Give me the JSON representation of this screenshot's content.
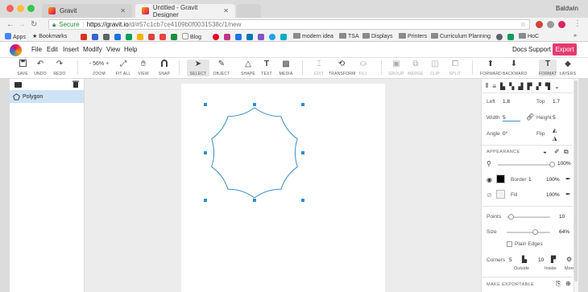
{
  "browser": {
    "tabs": [
      {
        "title": "Gravit",
        "active": false
      },
      {
        "title": "Untitled - Gravit Designer",
        "active": true
      }
    ],
    "profile_name": "Baldwin",
    "secure_label": "Secure",
    "url_host": "https://gravit.io",
    "url_path": "/d/#57c1cb7ce4109b0f0031538c/1/new",
    "bookmarks": [
      "Apps",
      "Bookmarks",
      "Blog",
      "modern idea",
      "TSA",
      "Displays",
      "Printers",
      "Curriculum Planning",
      "HoC"
    ],
    "more_label": "»"
  },
  "app": {
    "menus": [
      "File",
      "Edit",
      "Insert",
      "Modify",
      "View",
      "Help"
    ],
    "right_links": [
      "Docs",
      "Support"
    ],
    "export_label": "Export"
  },
  "toolbar": {
    "save": "SAVE",
    "undo": "UNDO",
    "redo": "REDO",
    "zoom_minus": "-",
    "zoom_value": "56%",
    "zoom_plus": "+",
    "zoom": "ZOOM",
    "fit_all": "FIT ALL",
    "view": "VIEW",
    "snap": "SNAP",
    "select": "SELECT",
    "object": "OBJECT",
    "shape": "SHAPE",
    "text": "TEXT",
    "media": "MEDIA",
    "edit": "EDIT",
    "transform": "TRANSFORM",
    "fill": "FILL",
    "group": "GROUP",
    "merge": "MERGE",
    "clip": "CLIP",
    "split": "SPLIT",
    "forward": "FORWARD",
    "backward": "BACKWARD",
    "format": "FORMAT",
    "layers": "LAYERS"
  },
  "layers": {
    "items": [
      {
        "name": "Polygon",
        "selected": true
      }
    ]
  },
  "inspector": {
    "left_label": "Left",
    "left_value": "1.8",
    "top_label": "Top",
    "top_value": "1.7",
    "width_label": "Width",
    "width_value": "5",
    "height_label": "Height",
    "height_value": "5",
    "angle_label": "Angle",
    "angle_value": "0°",
    "flip_label": "Flip",
    "appearance_title": "APPEARANCE",
    "opacity_value": "100%",
    "border_label": "Border",
    "border_width": "1",
    "border_opacity": "100%",
    "border_color": "#000000",
    "fill_label": "Fill",
    "fill_opacity": "100%",
    "fill_color": "#f2f2f2",
    "points_label": "Points",
    "points_value": "10",
    "points_fraction": 0.1,
    "size_label": "Size",
    "size_value": "64%",
    "size_fraction": 0.64,
    "plain_edges_label": "Plain Edges",
    "corners_label": "Corners",
    "corners_value1": "5",
    "corners_value2": "10",
    "outside_label": "Outside",
    "inside_label": "Inside",
    "more_label": "More",
    "make_exportable": "MAKE EXPORTABLE"
  },
  "colors": {
    "accent": "#2d8fd5",
    "export": "#e53a6f",
    "selection_row": "#cfe3f7",
    "shape_stroke": "#3a8fc9"
  }
}
